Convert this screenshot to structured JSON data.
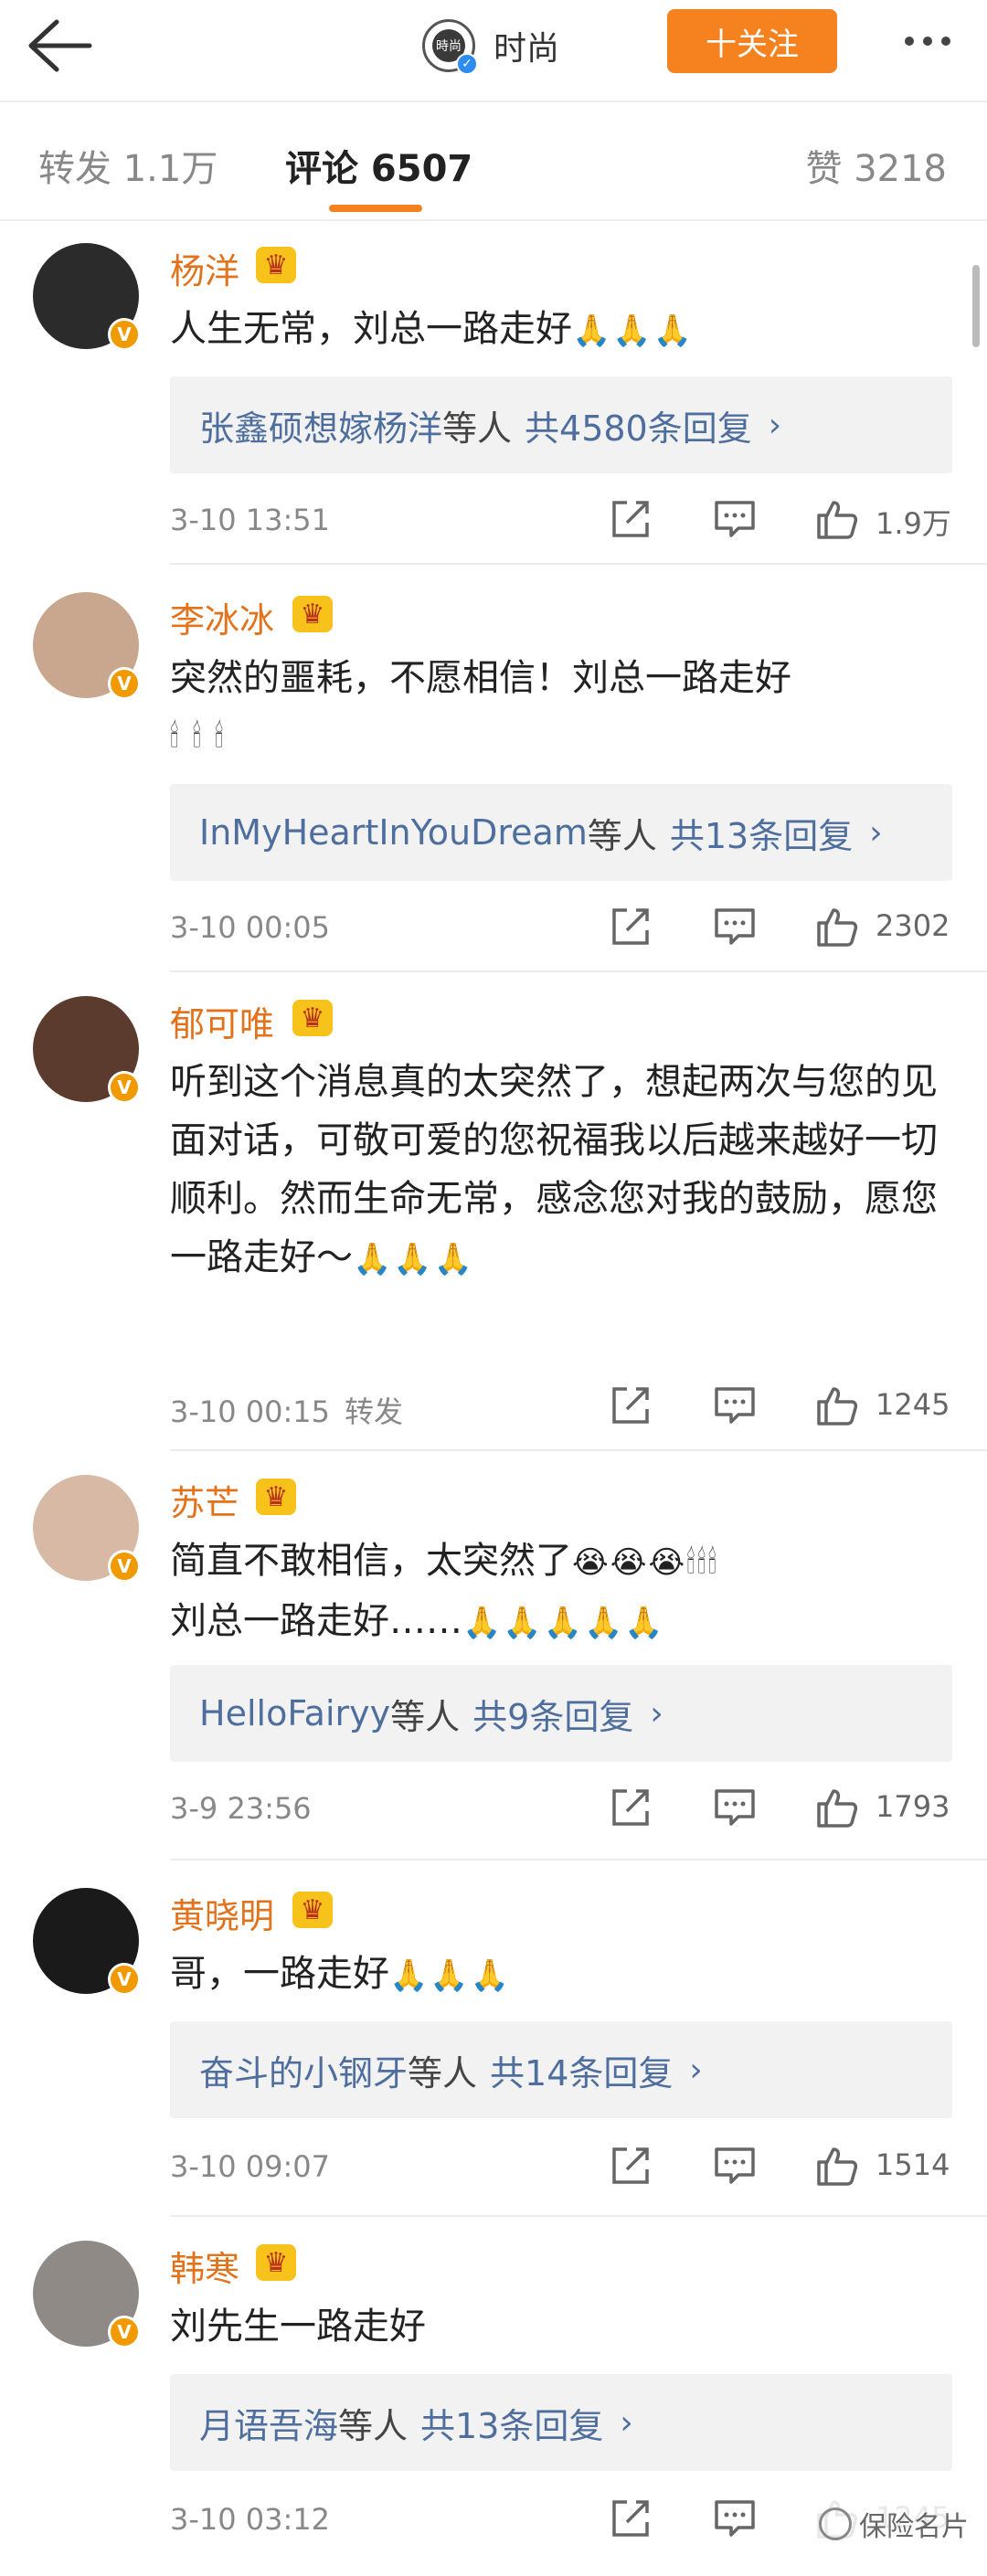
{
  "header": {
    "account_name": "时尚",
    "account_avatar_text": "時尚",
    "follow_label": "十关注"
  },
  "tabs": {
    "repost": "转发 1.1万",
    "comments": "评论 6507",
    "likes": "赞 3218"
  },
  "comments": [
    {
      "name": "杨洋",
      "text": "人生无常，刘总一路走好",
      "emoji": "🙏🙏🙏",
      "reply_users": "张鑫硕想嫁杨洋",
      "reply_mid": "等人",
      "reply_count": "共4580条回复",
      "time": "3-10 13:51",
      "source": "",
      "likes": "1.9万",
      "avatar_color": "#2b2b2b"
    },
    {
      "name": "李冰冰",
      "text": "突然的噩耗，不愿相信！刘总一路走好",
      "emoji": "🕯 🕯 🕯",
      "reply_users": "InMyHeartInYouDream",
      "reply_mid": "等人",
      "reply_count": "共13条回复",
      "time": "3-10 00:05",
      "source": "",
      "likes": "2302",
      "avatar_color": "#c9a78e"
    },
    {
      "name": "郁可唯",
      "text": "听到这个消息真的太突然了，想起两次与您的见面对话，可敬可爱的您祝福我以后越来越好一切顺利。然而生命无常，感念您对我的鼓励，愿您一路走好～",
      "emoji": "🙏🙏🙏",
      "reply_users": "",
      "reply_mid": "",
      "reply_count": "",
      "time": "3-10 00:15",
      "source": "转发",
      "likes": "1245",
      "avatar_color": "#5a3b2e"
    },
    {
      "name": "苏芒",
      "text": "简直不敢相信，太突然了",
      "emoji": "😭😭😭🕯🕯🕯",
      "text2": "刘总一路走好……",
      "emoji2": "🙏🙏🙏🙏🙏",
      "reply_users": "HelloFairyy",
      "reply_mid": "等人",
      "reply_count": "共9条回复",
      "time": "3-9 23:56",
      "source": "",
      "likes": "1793",
      "avatar_color": "#d8b9a6"
    },
    {
      "name": "黄晓明",
      "text": "哥，一路走好",
      "emoji": "🙏🙏🙏",
      "reply_users": "奋斗的小钢牙",
      "reply_mid": "等人",
      "reply_count": "共14条回复",
      "time": "3-10 09:07",
      "source": "",
      "likes": "1514",
      "avatar_color": "#1a1a1a"
    },
    {
      "name": "韩寒",
      "text": "刘先生一路走好",
      "emoji": "",
      "reply_users": "月语吾海",
      "reply_mid": "等人",
      "reply_count": "共13条回复",
      "time": "3-10 03:12",
      "source": "",
      "likes": "1245",
      "avatar_color": "#8f8a86"
    }
  ],
  "badges": {
    "verified": "V",
    "crown": "♛",
    "chevron": "›"
  },
  "watermark": "保险名片",
  "colors": {
    "accent": "#f5821f",
    "username": "#e2731c",
    "link": "#4e6e9e",
    "verified": "#f19a00"
  }
}
